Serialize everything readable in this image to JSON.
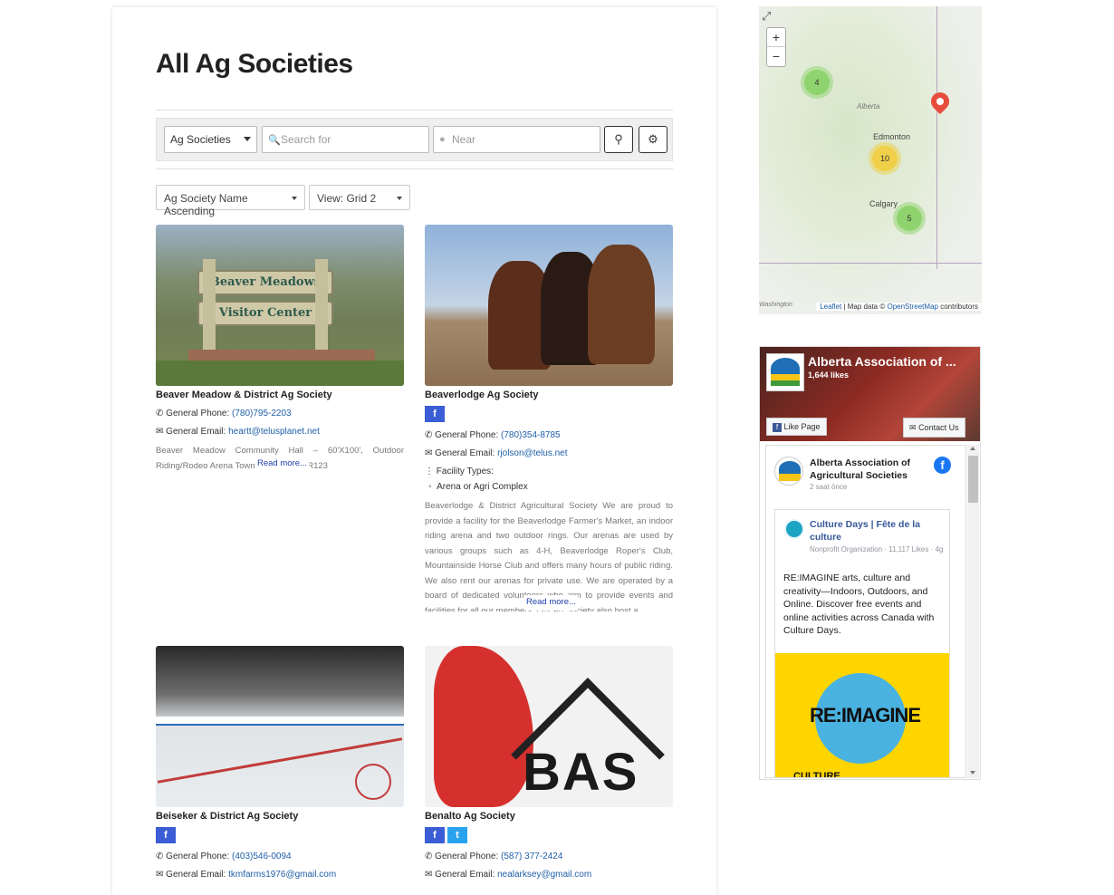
{
  "page": {
    "title": "All Ag Societies"
  },
  "search": {
    "category": "Ag Societies",
    "search_placeholder": "Search for",
    "near_placeholder": "Near"
  },
  "sort": {
    "label": "Ag Society Name Ascending",
    "view": "View: Grid 2"
  },
  "cards": [
    {
      "name": "Beaver Meadow & District Ag Society",
      "phone_label": "General Phone:",
      "phone": "(780)795-2203",
      "email_label": "General Email:",
      "email": "heartt@telusplanet.net",
      "desc": "Beaver Meadow Community Hall – 60'X100', Outdoor Riding/Rodeo Arena Township Road LRR123",
      "readmore": "Read more...",
      "sign_line1": "Beaver Meadows",
      "sign_line2": "Visitor Center"
    },
    {
      "name": "Beaverlodge Ag Society",
      "phone_label": "General Phone:",
      "phone": "(780)354-8785",
      "email_label": "General Email:",
      "email": "rjolson@telus.net",
      "facility_label": "Facility Types:",
      "facility": "Arena or Agri Complex",
      "desc": "Beaverlodge & District Agricultural Society We are proud to provide a facility for the Beaverlodge Farmer's Market, an indoor riding arena and two outdoor rings. Our arenas are used by various groups such as 4-H, Beaverlodge Roper's Club, Mountainside Horse Club and offers many hours of public riding. We also rent our arenas for private use. We are operated by a board of dedicated volunteers who aim to provide events and facilities for all our members. Our Ag Society also host a",
      "readmore": "Read more..."
    },
    {
      "name": "Beiseker & District Ag Society",
      "phone_label": "General Phone:",
      "phone": "(403)546-0094",
      "email_label": "General Email:",
      "email": "tkmfarms1976@gmail.com"
    },
    {
      "name": "Benalto Ag Society",
      "phone_label": "General Phone:",
      "phone": "(587) 377-2424",
      "email_label": "General Email:",
      "email": "nealarksey@gmail.com",
      "logo_text": "BAS"
    }
  ],
  "map": {
    "zoom_in": "+",
    "zoom_out": "−",
    "clusters": [
      {
        "count": "4"
      },
      {
        "count": "10"
      },
      {
        "count": "5"
      }
    ],
    "places": {
      "alberta": "Alberta",
      "edmonton": "Edmonton",
      "calgary": "Calgary",
      "washington": "Washington"
    },
    "attribution_leaflet": "Leaflet",
    "attribution_mid": "| Map data ©",
    "attribution_osm": "OpenStreetMap",
    "attribution_end": "contributors"
  },
  "facebook": {
    "page_name": "Alberta Association of ...",
    "likes": "1,644 likes",
    "like_btn": "Like Page",
    "contact_btn": "Contact Us",
    "post_author": "Alberta Association of Agricultural Societies",
    "post_time": "2 saat önce",
    "shared_page": "Culture Days | Fête de la culture",
    "shared_meta": "Nonprofit Organization · 11,117 Likes · 4g",
    "post_text": "RE:IMAGINE arts, culture and creativity—Indoors, Outdoors, and Online. Discover free events and online activities across Canada with Culture Days.",
    "poster_text": "RE:IMAGINE",
    "poster_sub": "CULTURE"
  }
}
